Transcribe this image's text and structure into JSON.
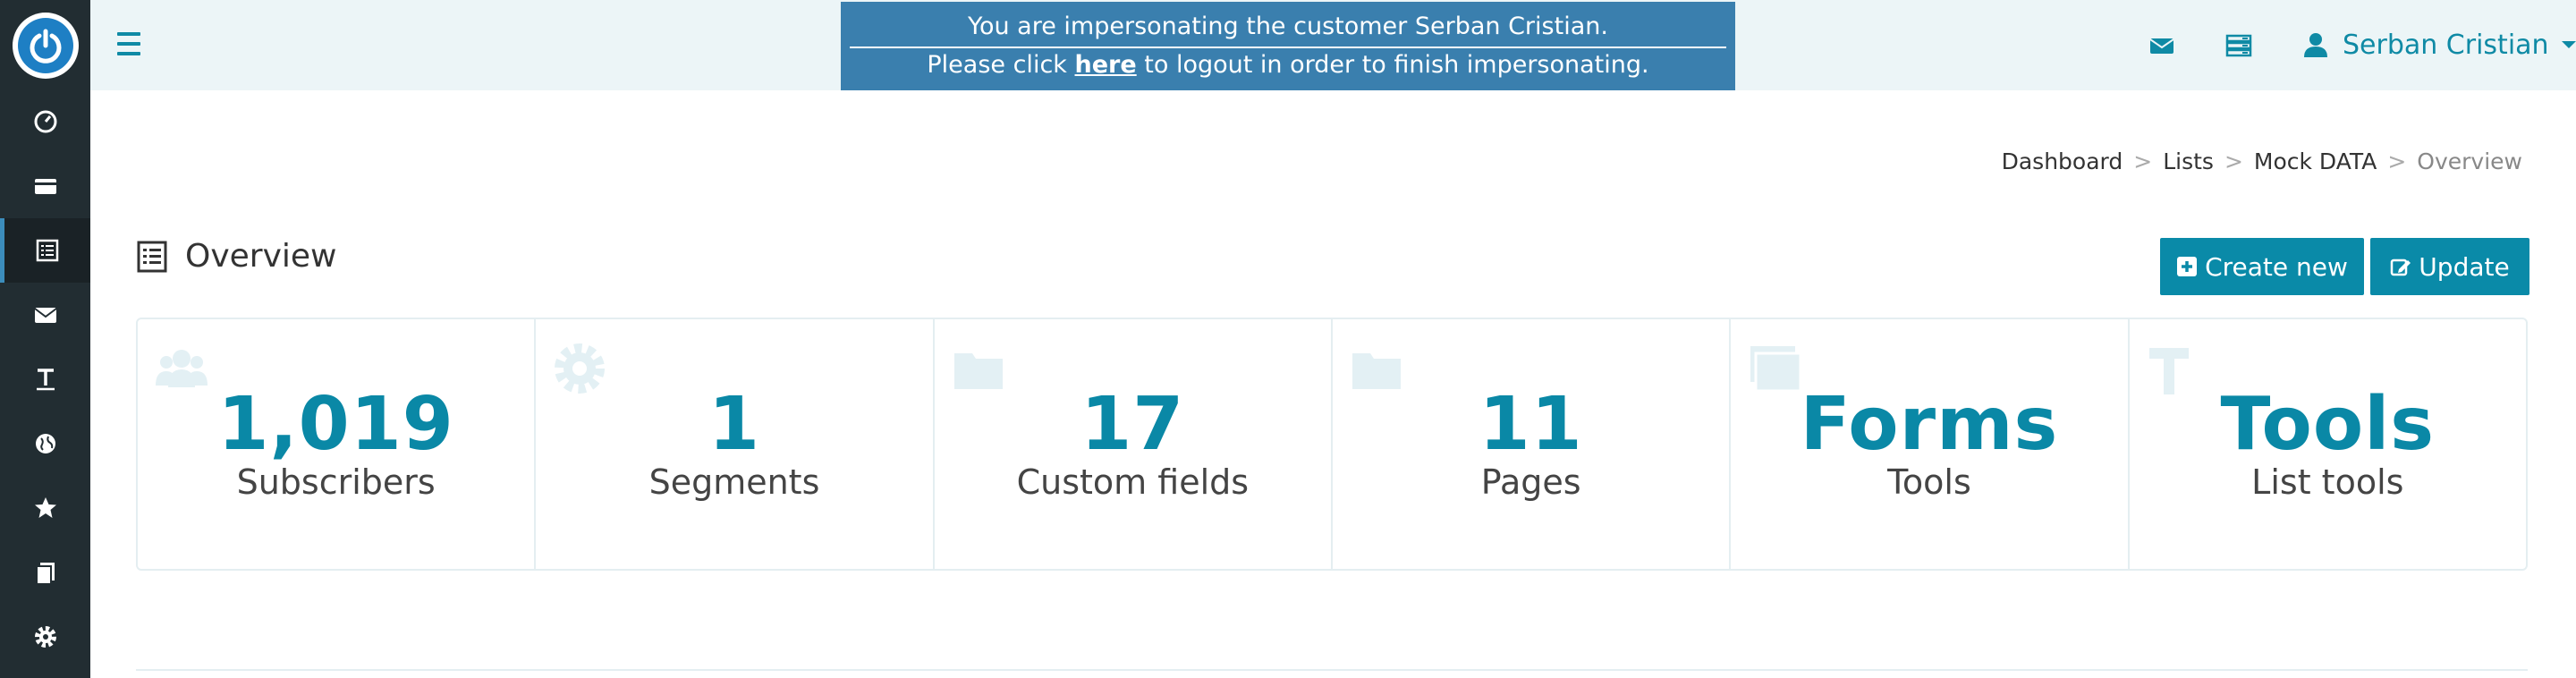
{
  "header": {
    "impersonation": {
      "line1": "You are impersonating the customer Serban Cristian.",
      "line2_prefix": "Please click ",
      "line2_link": "here",
      "line2_suffix": " to logout in order to finish impersonating."
    },
    "user_name": "Serban Cristian",
    "icons": [
      "envelope-icon",
      "server-icon",
      "user-icon"
    ]
  },
  "sidebar": {
    "items": [
      {
        "icon": "dashboard-icon",
        "active": false
      },
      {
        "icon": "credit-card-icon",
        "active": false
      },
      {
        "icon": "list-icon",
        "active": true
      },
      {
        "icon": "envelope-icon",
        "active": false
      },
      {
        "icon": "text-icon",
        "active": false
      },
      {
        "icon": "globe-icon",
        "active": false
      },
      {
        "icon": "star-icon",
        "active": false
      },
      {
        "icon": "files-icon",
        "active": false
      },
      {
        "icon": "gear-icon",
        "active": false
      }
    ]
  },
  "breadcrumb": {
    "items": [
      "Dashboard",
      "Lists",
      "Mock DATA"
    ],
    "separator": ">",
    "current": "Overview"
  },
  "page": {
    "title": "Overview",
    "create_label": "Create new",
    "update_label": "Update"
  },
  "stats": [
    {
      "value": "1,019",
      "label": "Subscribers",
      "icon": "users-icon"
    },
    {
      "value": "1",
      "label": "Segments",
      "icon": "gear-icon"
    },
    {
      "value": "17",
      "label": "Custom fields",
      "icon": "folder-icon"
    },
    {
      "value": "11",
      "label": "Pages",
      "icon": "folder-icon"
    },
    {
      "value": "Forms",
      "label": "Tools",
      "icon": "windows-icon"
    },
    {
      "value": "Tools",
      "label": "List tools",
      "icon": "hammer-icon"
    }
  ],
  "colors": {
    "accent": "#0a88a6",
    "sidebar": "#222d32",
    "header_bg": "#ecf5f7",
    "impersonation_bg": "#3a7fae"
  }
}
